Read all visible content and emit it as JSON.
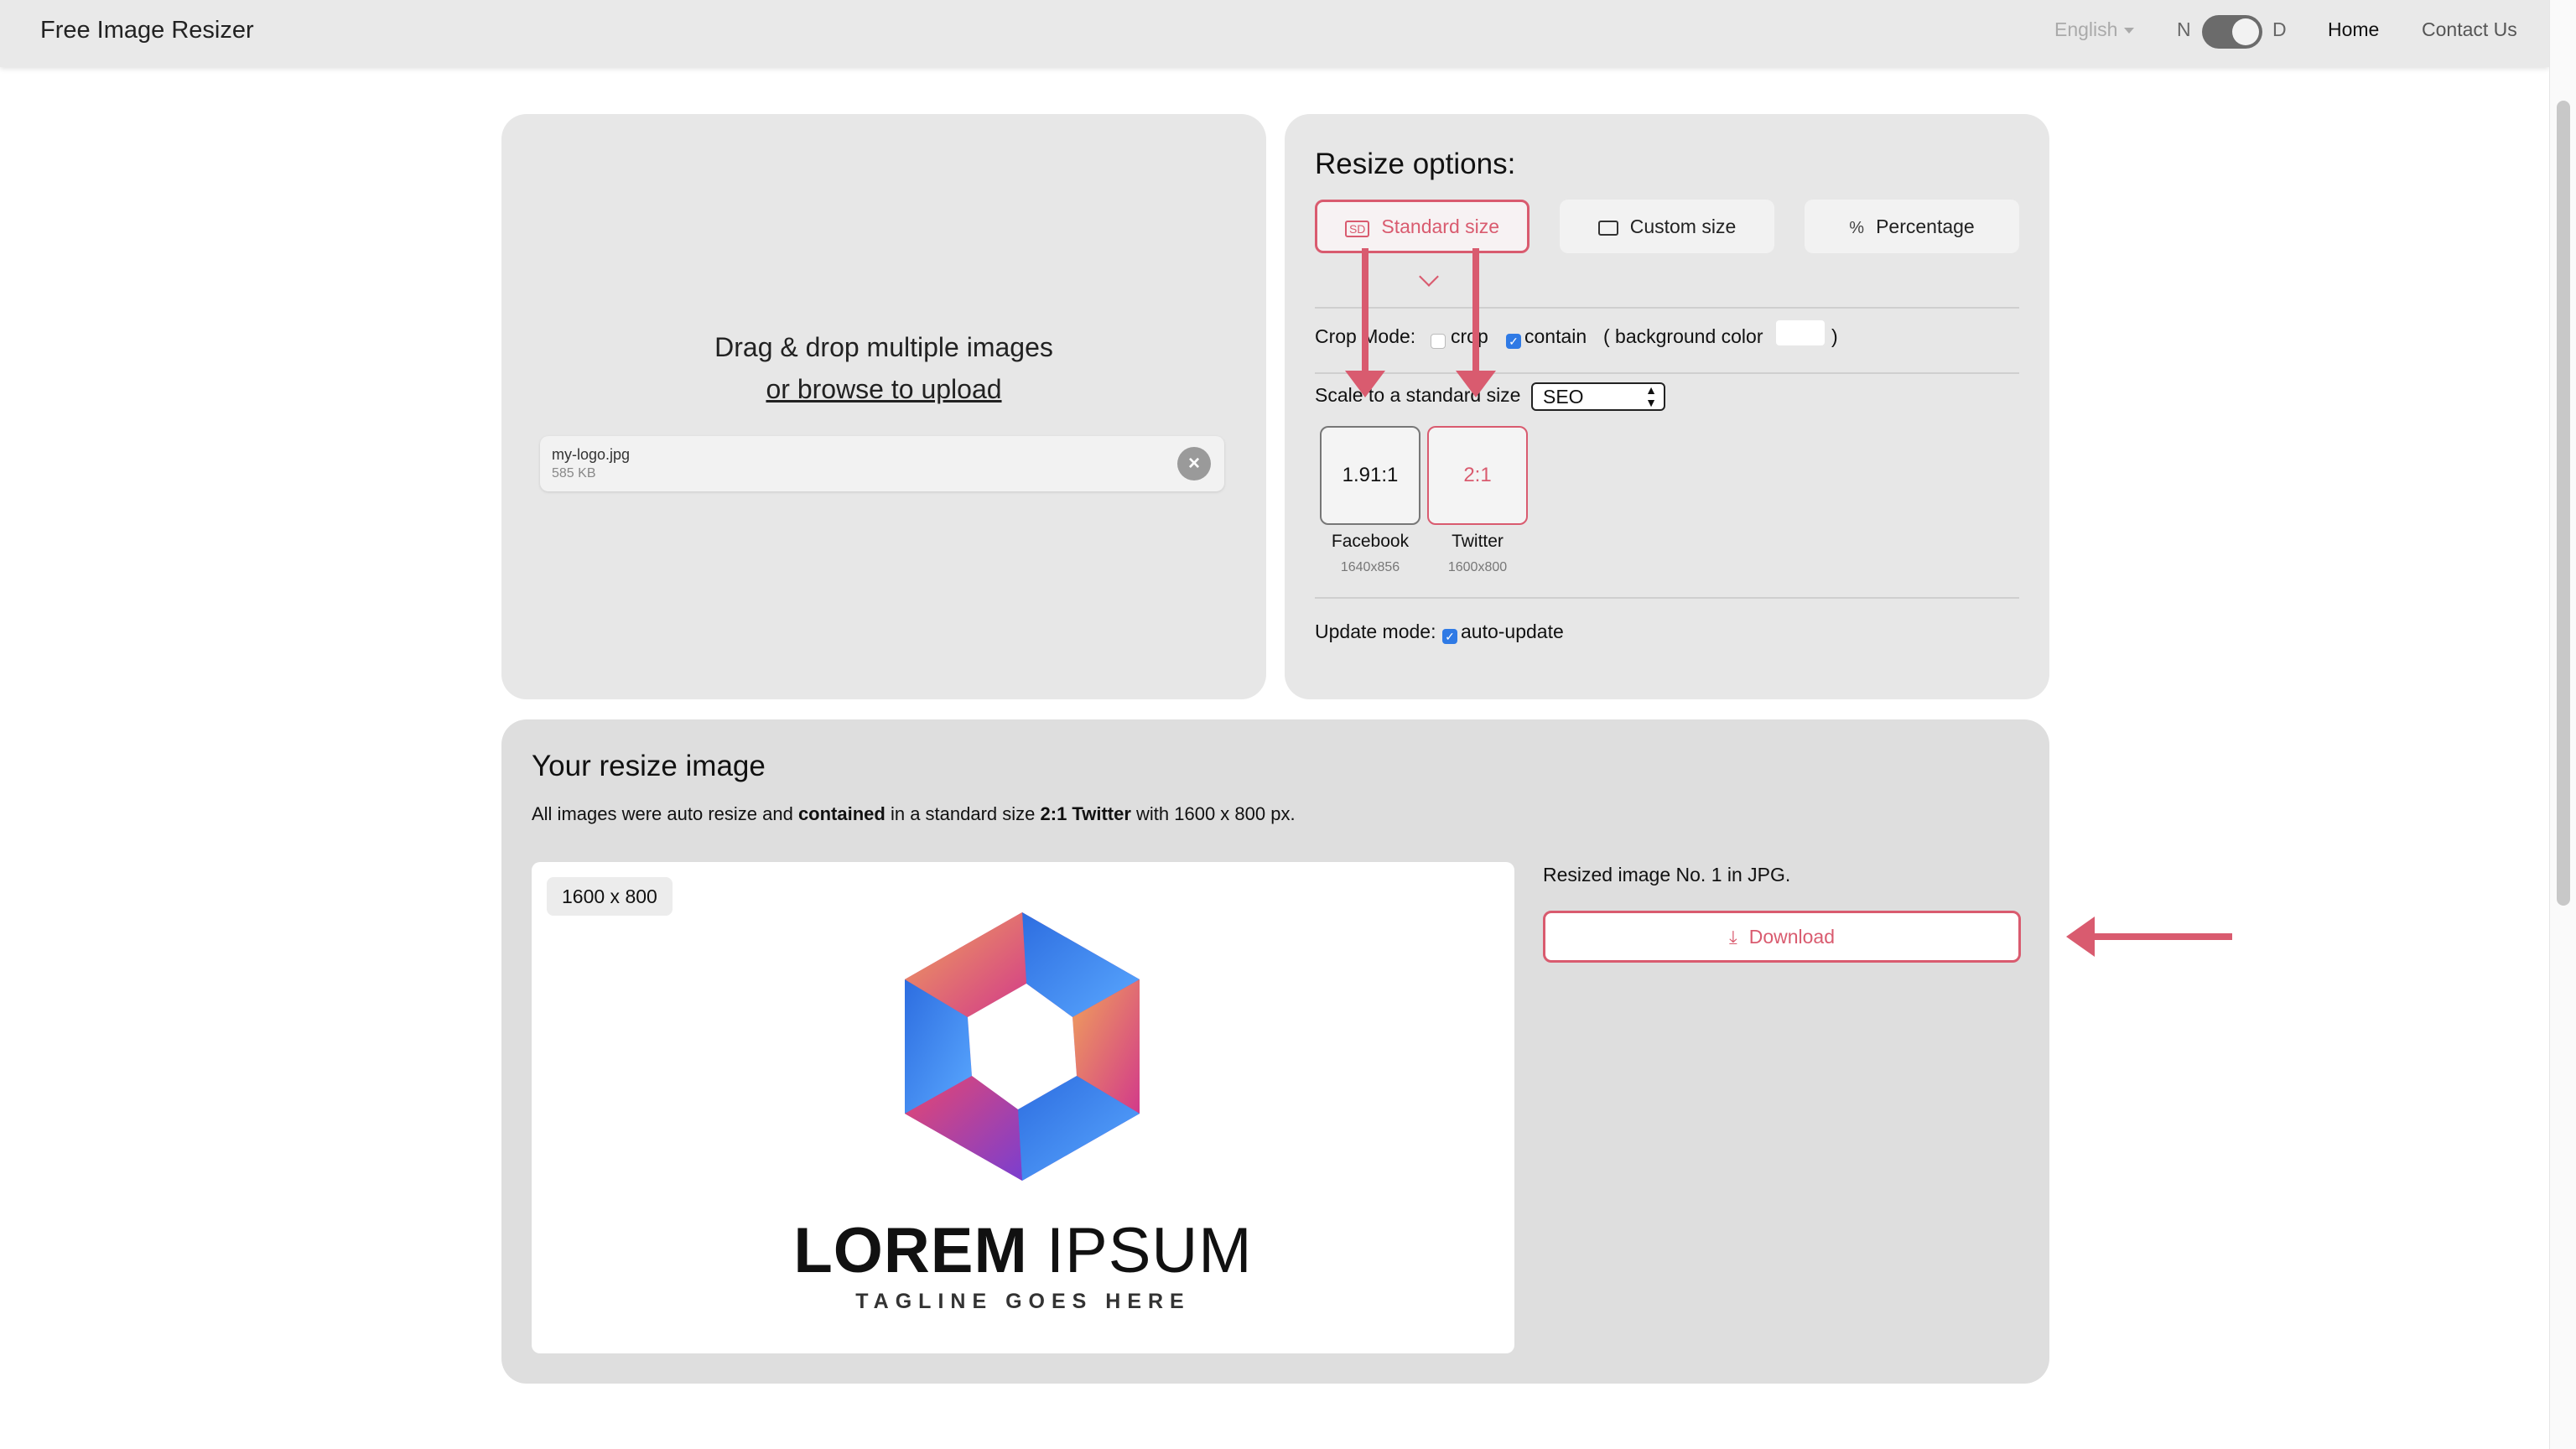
{
  "header": {
    "brand": "Free Image Resizer",
    "language": "English",
    "theme_left": "N",
    "theme_right": "D",
    "nav_home": "Home",
    "nav_contact": "Contact Us"
  },
  "upload": {
    "drop_line1": "Drag & drop multiple images",
    "drop_line2": "or browse to upload",
    "file": {
      "name": "my-logo.jpg",
      "size": "585 KB",
      "remove_icon": "×"
    }
  },
  "options": {
    "title": "Resize options:",
    "tabs": [
      {
        "label": "Standard size",
        "icon": "SD",
        "selected": true
      },
      {
        "label": "Custom size",
        "icon": "frame-icon"
      },
      {
        "label": "Percentage",
        "icon": "%"
      }
    ],
    "crop": {
      "label": "Crop Mode:",
      "crop_label": "crop",
      "crop_checked": false,
      "contain_label": "contain",
      "contain_checked": true,
      "bg_label": "( background color",
      "bg_close": ")",
      "bg_color": "#ffffff"
    },
    "scale": {
      "label": "Scale to a standard size",
      "selected": "SEO"
    },
    "sizes": [
      {
        "ratio": "1.91:1",
        "name": "Facebook",
        "dims": "1640x856"
      },
      {
        "ratio": "2:1",
        "name": "Twitter",
        "dims": "1600x800",
        "selected": true
      }
    ],
    "update": {
      "label": "Update mode:",
      "auto_label": "auto-update",
      "auto_checked": true
    }
  },
  "result": {
    "title": "Your resize image",
    "desc_part1": "All images were auto resize and ",
    "desc_bold1": "contained",
    "desc_part2": " in a standard size ",
    "desc_bold2": "2:1 Twitter",
    "desc_part3": " with 1600 x 800 px.",
    "badge": "1600 x 800",
    "logo_bold": "LOREM",
    "logo_light": "IPSUM",
    "logo_tagline": "TAGLINE GOES HERE",
    "info": "Resized image No. 1 in JPG.",
    "download_label": "Download"
  },
  "colors": {
    "accent": "#d95b6f",
    "card_bg": "#e7e7e7",
    "checkbox": "#2f7ae5"
  }
}
